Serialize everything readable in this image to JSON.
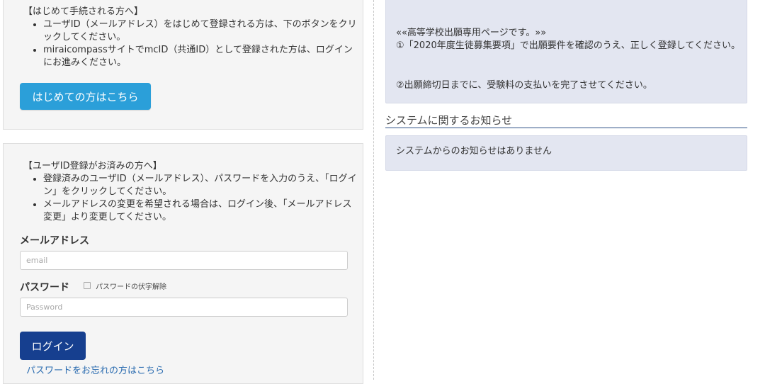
{
  "first_time": {
    "heading": "【はじめて手続される方へ】",
    "bullets": [
      "ユーザID（メールアドレス）をはじめて登録される方は、下のボタンをクリックしてください。",
      "miraicompassサイトでmcID（共通ID）として登録された方は、ログインにお進みください。"
    ],
    "button_label": "はじめての方はこちら"
  },
  "login": {
    "heading": "【ユーザID登録がお済みの方へ】",
    "bullets": [
      "登録済みのユーザID（メールアドレス）、パスワードを入力のうえ、「ログイン」をクリックしてください。",
      "メールアドレスの変更を希望される場合は、ログイン後、「メールアドレス変更」より変更してください。"
    ],
    "email_label": "メールアドレス",
    "email_placeholder": "email",
    "email_value": "",
    "password_label": "パスワード",
    "show_password_label": "パスワードの伏字解除",
    "show_password_checked": false,
    "password_placeholder": "Password",
    "password_value": "",
    "login_button_label": "ログイン",
    "forgot_link": "パスワードをお忘れの方はこちら"
  },
  "notice": {
    "line1": "««高等学校出願専用ページです。»»",
    "line2": "①「2020年度生徒募集要項」で出願要件を確認のうえ、正しく登録してください。",
    "line3": "②出願締切日までに、受験料の支払いを完了させてください。"
  },
  "system": {
    "title": "システムに関するお知らせ",
    "message": "システムからのお知らせはありません"
  },
  "colors": {
    "first_button": "#2b9fd9",
    "login_button": "#163f8f",
    "link": "#2b6cb0",
    "notice_bg": "#e3e6f1",
    "section_rule": "#2d4f86"
  }
}
